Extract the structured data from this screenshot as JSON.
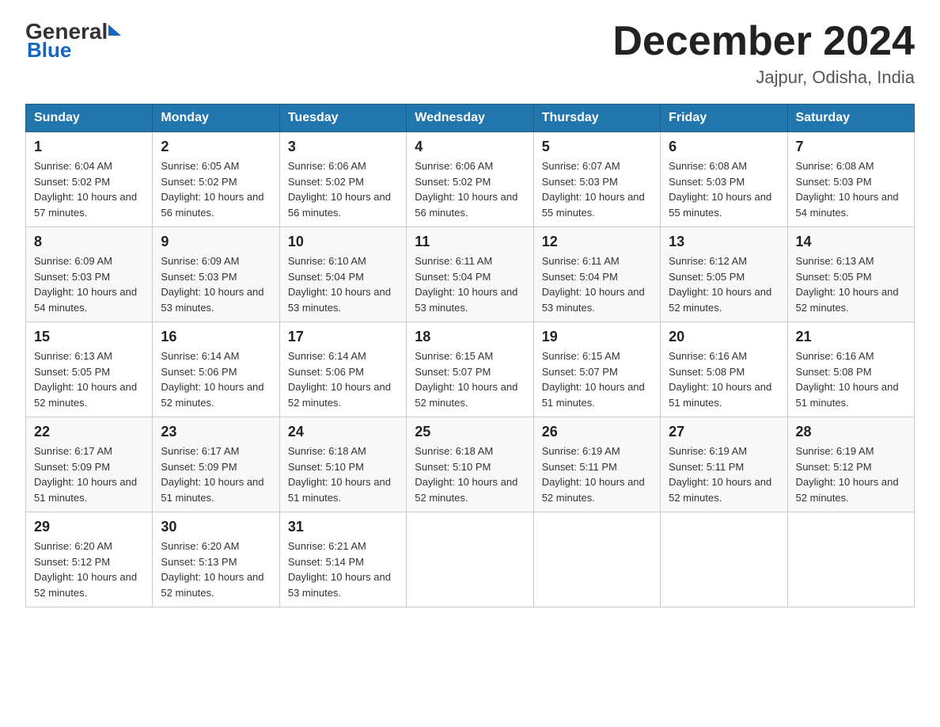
{
  "logo": {
    "text_general": "General",
    "text_blue": "Blue"
  },
  "header": {
    "title": "December 2024",
    "subtitle": "Jajpur, Odisha, India"
  },
  "days_of_week": [
    "Sunday",
    "Monday",
    "Tuesday",
    "Wednesday",
    "Thursday",
    "Friday",
    "Saturday"
  ],
  "weeks": [
    [
      {
        "day": "1",
        "sunrise": "6:04 AM",
        "sunset": "5:02 PM",
        "daylight": "10 hours and 57 minutes."
      },
      {
        "day": "2",
        "sunrise": "6:05 AM",
        "sunset": "5:02 PM",
        "daylight": "10 hours and 56 minutes."
      },
      {
        "day": "3",
        "sunrise": "6:06 AM",
        "sunset": "5:02 PM",
        "daylight": "10 hours and 56 minutes."
      },
      {
        "day": "4",
        "sunrise": "6:06 AM",
        "sunset": "5:02 PM",
        "daylight": "10 hours and 56 minutes."
      },
      {
        "day": "5",
        "sunrise": "6:07 AM",
        "sunset": "5:03 PM",
        "daylight": "10 hours and 55 minutes."
      },
      {
        "day": "6",
        "sunrise": "6:08 AM",
        "sunset": "5:03 PM",
        "daylight": "10 hours and 55 minutes."
      },
      {
        "day": "7",
        "sunrise": "6:08 AM",
        "sunset": "5:03 PM",
        "daylight": "10 hours and 54 minutes."
      }
    ],
    [
      {
        "day": "8",
        "sunrise": "6:09 AM",
        "sunset": "5:03 PM",
        "daylight": "10 hours and 54 minutes."
      },
      {
        "day": "9",
        "sunrise": "6:09 AM",
        "sunset": "5:03 PM",
        "daylight": "10 hours and 53 minutes."
      },
      {
        "day": "10",
        "sunrise": "6:10 AM",
        "sunset": "5:04 PM",
        "daylight": "10 hours and 53 minutes."
      },
      {
        "day": "11",
        "sunrise": "6:11 AM",
        "sunset": "5:04 PM",
        "daylight": "10 hours and 53 minutes."
      },
      {
        "day": "12",
        "sunrise": "6:11 AM",
        "sunset": "5:04 PM",
        "daylight": "10 hours and 53 minutes."
      },
      {
        "day": "13",
        "sunrise": "6:12 AM",
        "sunset": "5:05 PM",
        "daylight": "10 hours and 52 minutes."
      },
      {
        "day": "14",
        "sunrise": "6:13 AM",
        "sunset": "5:05 PM",
        "daylight": "10 hours and 52 minutes."
      }
    ],
    [
      {
        "day": "15",
        "sunrise": "6:13 AM",
        "sunset": "5:05 PM",
        "daylight": "10 hours and 52 minutes."
      },
      {
        "day": "16",
        "sunrise": "6:14 AM",
        "sunset": "5:06 PM",
        "daylight": "10 hours and 52 minutes."
      },
      {
        "day": "17",
        "sunrise": "6:14 AM",
        "sunset": "5:06 PM",
        "daylight": "10 hours and 52 minutes."
      },
      {
        "day": "18",
        "sunrise": "6:15 AM",
        "sunset": "5:07 PM",
        "daylight": "10 hours and 52 minutes."
      },
      {
        "day": "19",
        "sunrise": "6:15 AM",
        "sunset": "5:07 PM",
        "daylight": "10 hours and 51 minutes."
      },
      {
        "day": "20",
        "sunrise": "6:16 AM",
        "sunset": "5:08 PM",
        "daylight": "10 hours and 51 minutes."
      },
      {
        "day": "21",
        "sunrise": "6:16 AM",
        "sunset": "5:08 PM",
        "daylight": "10 hours and 51 minutes."
      }
    ],
    [
      {
        "day": "22",
        "sunrise": "6:17 AM",
        "sunset": "5:09 PM",
        "daylight": "10 hours and 51 minutes."
      },
      {
        "day": "23",
        "sunrise": "6:17 AM",
        "sunset": "5:09 PM",
        "daylight": "10 hours and 51 minutes."
      },
      {
        "day": "24",
        "sunrise": "6:18 AM",
        "sunset": "5:10 PM",
        "daylight": "10 hours and 51 minutes."
      },
      {
        "day": "25",
        "sunrise": "6:18 AM",
        "sunset": "5:10 PM",
        "daylight": "10 hours and 52 minutes."
      },
      {
        "day": "26",
        "sunrise": "6:19 AM",
        "sunset": "5:11 PM",
        "daylight": "10 hours and 52 minutes."
      },
      {
        "day": "27",
        "sunrise": "6:19 AM",
        "sunset": "5:11 PM",
        "daylight": "10 hours and 52 minutes."
      },
      {
        "day": "28",
        "sunrise": "6:19 AM",
        "sunset": "5:12 PM",
        "daylight": "10 hours and 52 minutes."
      }
    ],
    [
      {
        "day": "29",
        "sunrise": "6:20 AM",
        "sunset": "5:12 PM",
        "daylight": "10 hours and 52 minutes."
      },
      {
        "day": "30",
        "sunrise": "6:20 AM",
        "sunset": "5:13 PM",
        "daylight": "10 hours and 52 minutes."
      },
      {
        "day": "31",
        "sunrise": "6:21 AM",
        "sunset": "5:14 PM",
        "daylight": "10 hours and 53 minutes."
      },
      null,
      null,
      null,
      null
    ]
  ],
  "labels": {
    "sunrise": "Sunrise: ",
    "sunset": "Sunset: ",
    "daylight": "Daylight: "
  }
}
